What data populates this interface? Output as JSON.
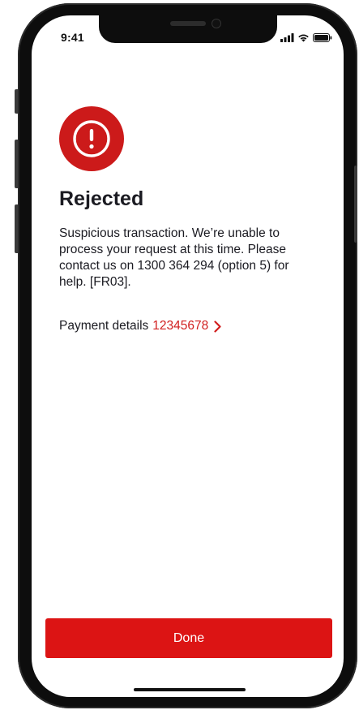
{
  "status_bar": {
    "time": "9:41",
    "icons": [
      "cellular-signal-icon",
      "wifi-icon",
      "battery-icon"
    ]
  },
  "alert": {
    "icon": "exclamation-circle-icon",
    "title": "Rejected",
    "message": "Suspicious transaction. We’re unable to process your request at this time. Please contact us on 1300 364 294 (option 5) for help. [FR03]."
  },
  "payment": {
    "label": "Payment details",
    "reference": "12345678",
    "icon": "chevron-right-icon"
  },
  "actions": {
    "done_label": "Done"
  },
  "colors": {
    "accent": "#dc1414",
    "alert_red": "#cc1a1a",
    "link_red": "#d11f1f",
    "text": "#1b1b22"
  }
}
